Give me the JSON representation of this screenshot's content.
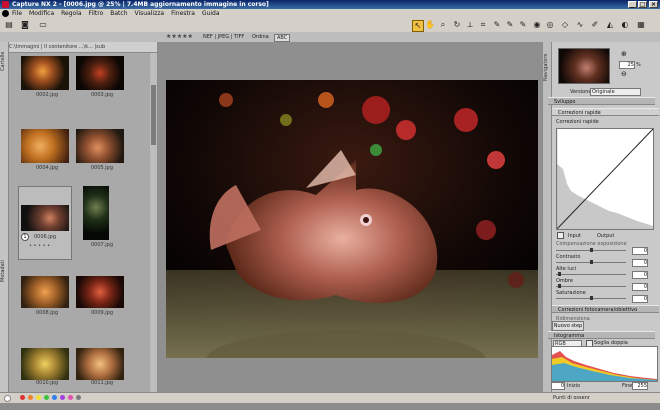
{
  "window": {
    "title": "Capture NX 2 - [0006.jpg @ 25% | 7.4MB aggiornamento immagine in corso]"
  },
  "menu": {
    "items": [
      "File",
      "Modifica",
      "Regola",
      "Filtro",
      "Batch",
      "Visualizza",
      "Finestra",
      "Guida"
    ]
  },
  "toolbar2": {
    "rating": "★★★★★",
    "format_filter": "NEF | JPEG | TIFF",
    "sort_label": "Ordina",
    "sort_value": "ABC"
  },
  "browser": {
    "header": "C:\\Immagini | Il contenitore ...\\k... |sub",
    "thumbnails": [
      {
        "caption": "0002.jpg"
      },
      {
        "caption": "0003.jpg"
      },
      {
        "caption": "0004.jpg"
      },
      {
        "caption": "0005.jpg"
      },
      {
        "caption": "0006.jpg"
      },
      {
        "caption": "0007.jpg"
      },
      {
        "caption": "0008.jpg"
      },
      {
        "caption": "0009.jpg"
      },
      {
        "caption": "0010.jpg"
      },
      {
        "caption": "0011.jpg"
      }
    ],
    "selected_badge": "1",
    "left_tabs": [
      "Cartelle",
      "Metadati"
    ]
  },
  "navigator": {
    "zoom_value": "25",
    "zoom_unit": "%",
    "tab": "Navigatore"
  },
  "develop": {
    "version_label": "Versione",
    "version_value": "Originale",
    "section_develop": "Sviluppo",
    "quick_fix": "Correzioni rapide",
    "quick_fix_inner": "Correzioni rapide",
    "input_label": "Input",
    "output_label": "Output",
    "exposure_label": "Compensazione esposizione",
    "contrast_label": "Contrasto",
    "highlights_label": "Alte luci",
    "shadows_label": "Ombre",
    "saturation_label": "Saturazione",
    "exposure_value": "0",
    "contrast_value": "0",
    "highlights_value": "0",
    "shadows_value": "0",
    "saturation_value": "0",
    "camera_lens": "Correzioni fotocamera/obiettivo",
    "resize": "Ridimensiona",
    "new_step_button": "Nuovo step"
  },
  "histogram": {
    "title": "Istogramma",
    "channel": "RGB",
    "double_threshold": "Soglia doppia",
    "start_label": "Inizio",
    "start_value": "0",
    "end_label": "Fine",
    "end_value": "255"
  },
  "points": {
    "label": "Punti di ossenr"
  }
}
